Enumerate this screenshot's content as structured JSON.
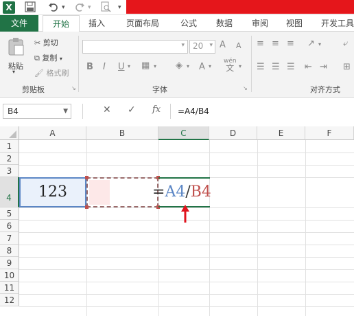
{
  "app": {
    "name": "Excel",
    "logo": "X"
  },
  "quick_access": {
    "icons": [
      "save-icon",
      "undo-icon",
      "redo-icon",
      "print-preview-icon"
    ]
  },
  "tabs": [
    {
      "label": "文件"
    },
    {
      "label": "开始"
    },
    {
      "label": "插入"
    },
    {
      "label": "页面布局"
    },
    {
      "label": "公式"
    },
    {
      "label": "数据"
    },
    {
      "label": "审阅"
    },
    {
      "label": "视图"
    },
    {
      "label": "开发工具"
    }
  ],
  "ribbon": {
    "clipboard": {
      "paste": "粘贴",
      "cut": "剪切",
      "copy": "复制",
      "format_painter": "格式刷",
      "group": "剪贴板"
    },
    "font": {
      "size": "20",
      "bold": "B",
      "italic": "I",
      "underline": "U",
      "grow": "A",
      "shrink": "A",
      "wen": "wén",
      "wen_char": "文",
      "group": "字体"
    },
    "alignment": {
      "group": "对齐方式"
    }
  },
  "formula_bar": {
    "name_box": "B4",
    "cancel": "✕",
    "enter": "✓",
    "fx": "fx",
    "formula": "=A4/B4"
  },
  "columns": [
    "A",
    "B",
    "C",
    "D",
    "E",
    "F"
  ],
  "rows": [
    "1",
    "2",
    "3",
    "4",
    "5",
    "6",
    "7",
    "8",
    "9",
    "10",
    "11",
    "12"
  ],
  "cells": {
    "A4": "123",
    "C4": {
      "eq": "=",
      "ref1": "A4",
      "slash": "/",
      "ref2": "B4"
    }
  },
  "colors": {
    "excel_green": "#217346",
    "ref_blue": "#5b86c5",
    "ref_red": "#c0504d",
    "title_red": "#e5161b",
    "arrow_red": "#e0141e"
  }
}
